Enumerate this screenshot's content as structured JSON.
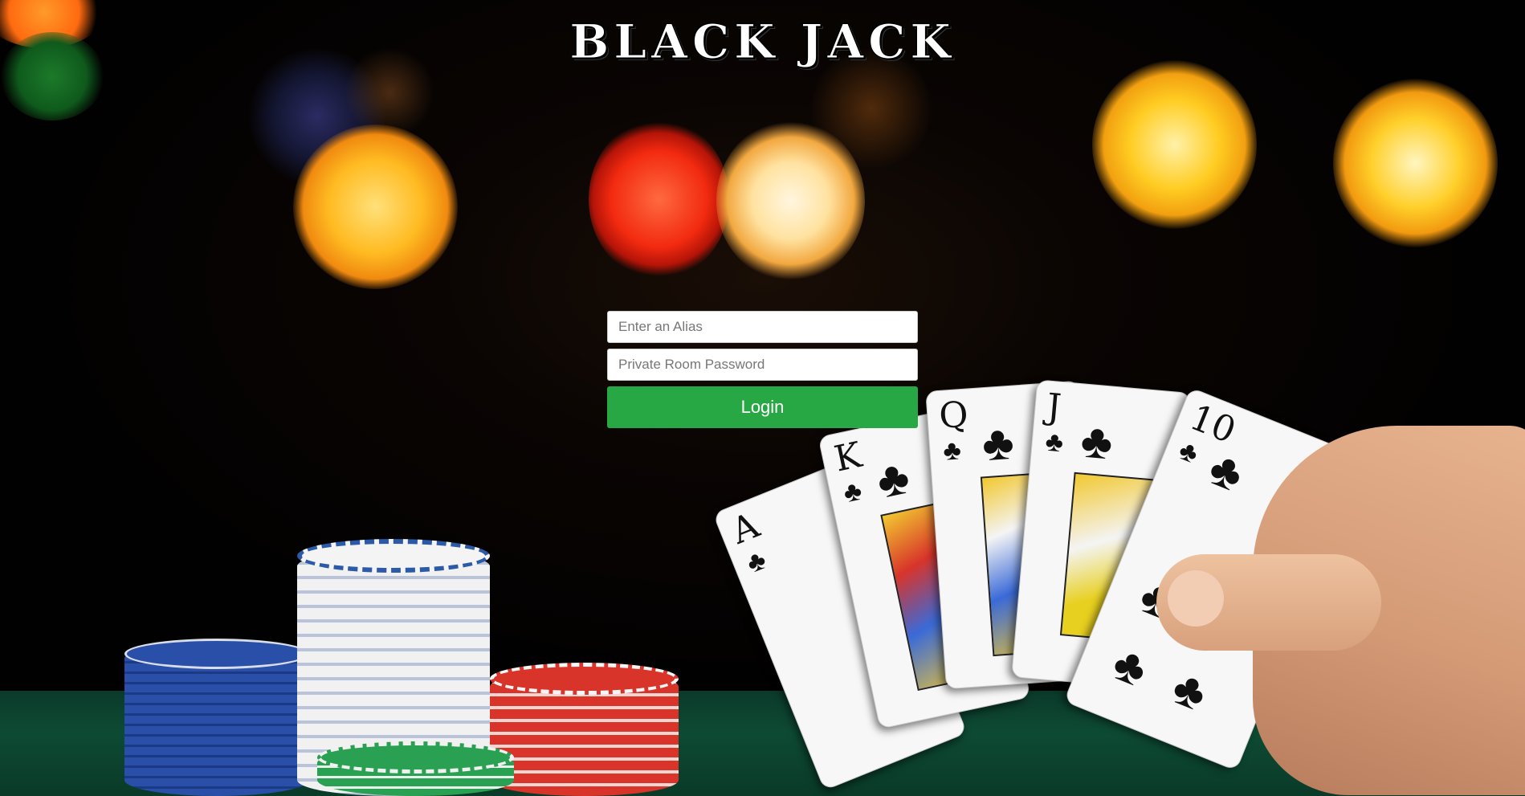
{
  "page": {
    "title": "BLACK JACK"
  },
  "login_form": {
    "alias_placeholder": "Enter an Alias",
    "password_placeholder": "Private Room Password",
    "login_label": "Login"
  },
  "colors": {
    "login_button": "#28a745",
    "felt": "#0d4a34"
  },
  "background": {
    "cards": [
      {
        "rank": "A",
        "suit": "♣"
      },
      {
        "rank": "K",
        "suit": "♣"
      },
      {
        "rank": "Q",
        "suit": "♣"
      },
      {
        "rank": "J",
        "suit": "♣"
      },
      {
        "rank": "10",
        "suit": "♣"
      }
    ]
  }
}
